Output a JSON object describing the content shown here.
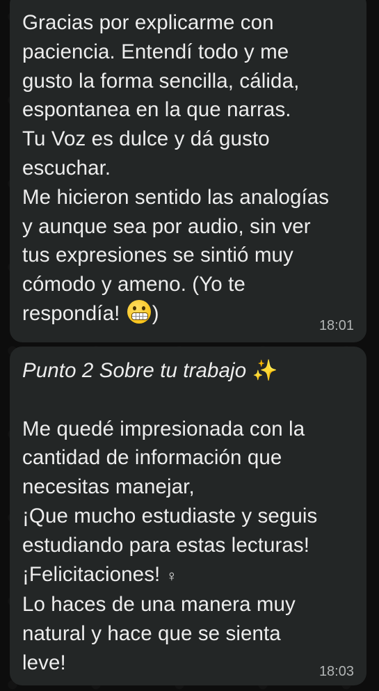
{
  "messages": [
    {
      "lines_before_emoji": "Gracias por explicarme con\npaciencia. Entendí todo y me\ngusto la forma sencilla, cálida,\nespontanea en la que narras.\nTu Voz es dulce y dá gusto\nescuchar.\nMe hicieron sentido las analogías\ny aunque sea por audio, sin ver\ntus expresiones se sintió muy\ncómodo y ameno.  (Yo te\nrespondía! ",
      "emoji": "grimacing-face-icon",
      "after_emoji": ")",
      "time": "18:01"
    },
    {
      "heading": "Punto 2 Sobre tu trabajo ",
      "heading_emoji": "✨",
      "body_before_symbol": "\nMe quedé impresionada con la\ncantidad de información que\nnecesitas manejar,\n¡Que mucho estudiaste y seguis\nestudiando para estas lecturas!\n¡Felicitaciones! ",
      "symbol": "♀",
      "body_after_symbol": "\nLo haces de una manera muy\nnatural y hace que se sienta\nleve!",
      "time": "18:03"
    }
  ]
}
